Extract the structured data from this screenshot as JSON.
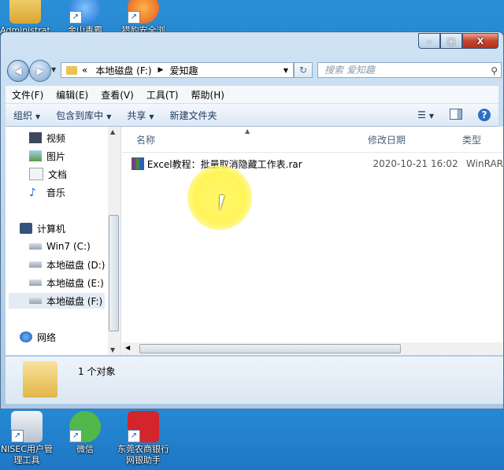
{
  "desktop": {
    "icons": [
      {
        "label": "Administrat",
        "icon": "user-folder-icon"
      },
      {
        "label": "金山毒霸",
        "icon": "antivirus-icon"
      },
      {
        "label": "猎豹安全浏",
        "icon": "browser-icon"
      },
      {
        "label": "NISEC用户管理工具",
        "icon": "tool-icon"
      },
      {
        "label": "微信",
        "icon": "wechat-icon"
      },
      {
        "label": "东莞农商银行网银助手",
        "icon": "bank-icon"
      }
    ]
  },
  "window": {
    "caption_buttons": {
      "minimize": "–",
      "maximize": "□",
      "close": "X"
    },
    "address": {
      "sep": "«",
      "segments": [
        "本地磁盘 (F:)",
        "爱知趣"
      ]
    },
    "search_placeholder": "搜索 爱知趣",
    "menu": [
      "文件(F)",
      "编辑(E)",
      "查看(V)",
      "工具(T)",
      "帮助(H)"
    ],
    "toolbar": {
      "organize": "组织",
      "include_library": "包含到库中",
      "share": "共享",
      "new_folder": "新建文件夹"
    },
    "nav": {
      "libraries": [
        "视频",
        "图片",
        "文档",
        "音乐"
      ],
      "computer": "计算机",
      "drives": [
        "Win7 (C:)",
        "本地磁盘 (D:)",
        "本地磁盘 (E:)",
        "本地磁盘 (F:)"
      ],
      "selected_drive": "本地磁盘 (F:)",
      "network": "网络"
    },
    "columns": {
      "name": "名称",
      "modified": "修改日期",
      "type": "类型"
    },
    "files": [
      {
        "name": "Excel教程：批量取消隐藏工作表.rar",
        "modified": "2020-10-21 16:02",
        "type": "WinRAR"
      }
    ],
    "status": "1 个对象"
  }
}
